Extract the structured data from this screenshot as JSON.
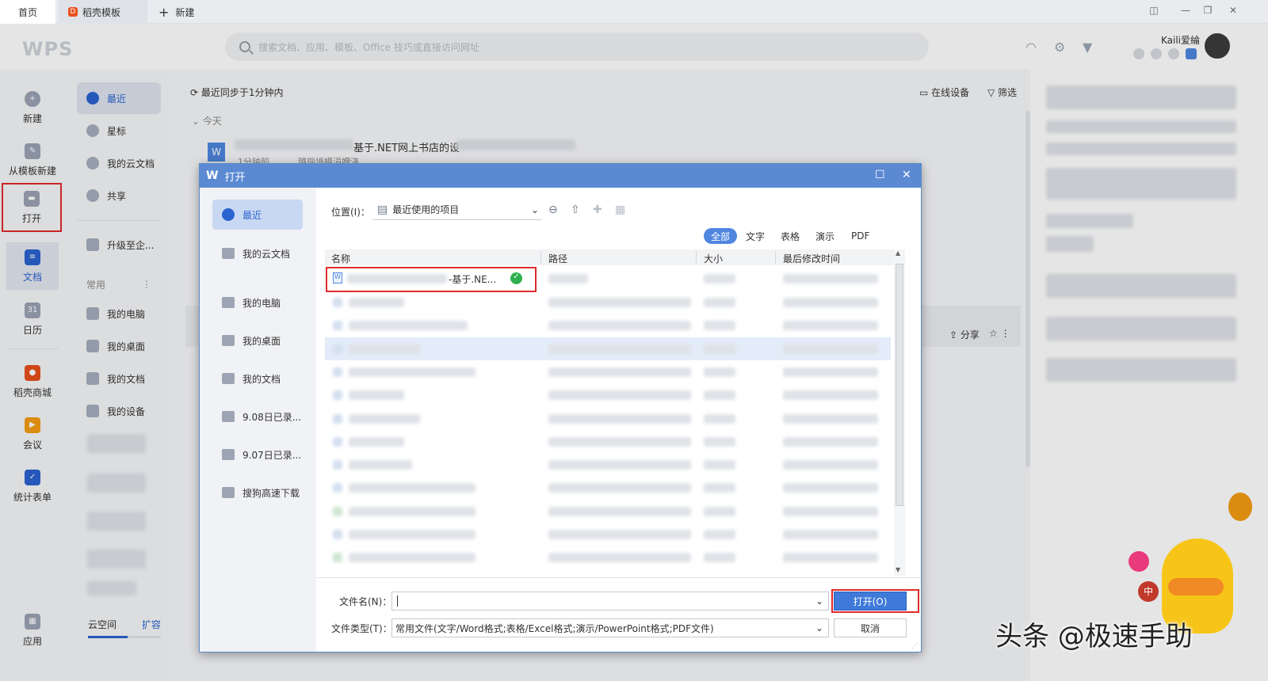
{
  "tabs": {
    "home": "首页",
    "template": "稻壳模板",
    "new": "新建"
  },
  "header": {
    "logo": "WPS",
    "search_placeholder": "搜索文档、应用、模板、Office 技巧或直接访问网址",
    "username": "Kaili爱綸"
  },
  "leftnav": [
    {
      "label": "新建",
      "icon": "plus-circle-icon"
    },
    {
      "label": "从模板新建",
      "icon": "template-icon"
    },
    {
      "label": "打开",
      "icon": "folder-icon"
    },
    {
      "label": "文档",
      "icon": "document-icon"
    },
    {
      "label": "日历",
      "icon": "calendar-icon"
    },
    {
      "label": "稻壳商城",
      "icon": "store-icon"
    },
    {
      "label": "会议",
      "icon": "meeting-icon"
    },
    {
      "label": "统计表单",
      "icon": "form-icon"
    },
    {
      "label": "应用",
      "icon": "apps-icon"
    }
  ],
  "sidebar": {
    "recent": "最近",
    "star": "星标",
    "cloud": "我的云文档",
    "share": "共享",
    "upgrade": "升级至企...",
    "common": "常用",
    "pc": "我的电脑",
    "desktop": "我的桌面",
    "docs": "我的文档",
    "devices": "我的设备",
    "cloudspace": "云空间",
    "expand": "扩容"
  },
  "main": {
    "sync": "最近同步于1分钟内",
    "online": "在线设备",
    "filter": "筛选",
    "today": "今天",
    "file_title": "基于.NET网上书店的设",
    "file_time": "1分钟前",
    "file_loc": "璐瑙堝櫒涓嬭浇",
    "share_label": "分享"
  },
  "dialog": {
    "title": "打开",
    "sidebar": [
      "最近",
      "我的云文档",
      "我的电脑",
      "我的桌面",
      "我的文档",
      "9.08日已录...",
      "9.07日已录...",
      "搜狗高速下载"
    ],
    "location_label": "位置(I)：",
    "location_value": "最近使用的项目",
    "filter_tabs": [
      "全部",
      "文字",
      "表格",
      "演示",
      "PDF"
    ],
    "columns": [
      "名称",
      "路径",
      "大小",
      "最后修改时间"
    ],
    "first_file": "-基于.NE...",
    "filename_label": "文件名(N)：",
    "filename_value": "",
    "filetype_label": "文件类型(T)：",
    "filetype_value": "常用文件(文字/Word格式;表格/Excel格式;演示/PowerPoint格式;PDF文件)",
    "open_button": "打开(O)",
    "cancel_button": "取消"
  },
  "watermark": "头条 @极速手助",
  "colors": {
    "accent": "#2b63d0",
    "highlight": "#e02b2b",
    "dialog_title": "#5b8ad3"
  }
}
